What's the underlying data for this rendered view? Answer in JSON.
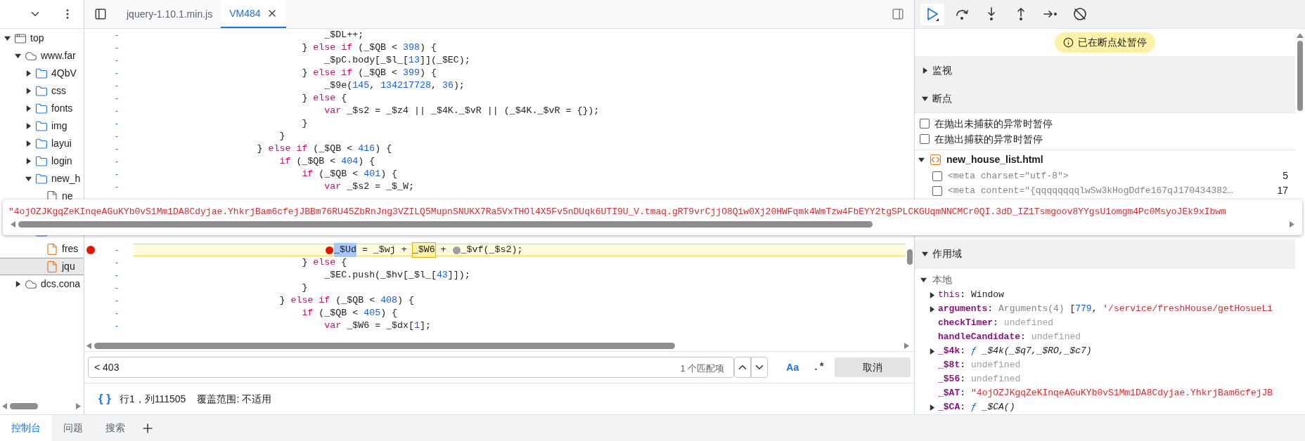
{
  "navigator": {
    "tree": [
      {
        "label": "top",
        "kind": "frame",
        "expanded": true,
        "selected": false,
        "children": [
          {
            "label": "www.far",
            "kind": "domain",
            "expanded": true,
            "selected": false,
            "children": [
              {
                "label": "4QbV",
                "kind": "folder",
                "expanded": false,
                "selected": false
              },
              {
                "label": "css",
                "kind": "folder",
                "expanded": false,
                "selected": false
              },
              {
                "label": "fonts",
                "kind": "folder",
                "expanded": false,
                "selected": false
              },
              {
                "label": "img",
                "kind": "folder",
                "expanded": false,
                "selected": false
              },
              {
                "label": "layui",
                "kind": "folder",
                "expanded": false,
                "selected": false
              },
              {
                "label": "login",
                "kind": "folder",
                "expanded": false,
                "selected": false
              },
              {
                "label": "new_h",
                "kind": "folder",
                "expanded": true,
                "selected": false,
                "children": [
                  {
                    "label": "ne",
                    "kind": "document",
                    "selected": false
                  }
                ]
              },
              {
                "kind": "folder",
                "selected": false,
                "children": [
                  {
                    "label": "fres",
                    "kind": "script",
                    "selected": false
                  },
                  {
                    "label": "jqu",
                    "kind": "script",
                    "selected": true
                  }
                ]
              }
            ]
          },
          {
            "label": "dcs.cona",
            "kind": "domain",
            "expanded": false,
            "selected": false
          }
        ]
      }
    ]
  },
  "editor": {
    "tabs": [
      {
        "label": "jquery-1.10.1.min.js",
        "selected": false,
        "closable": false
      },
      {
        "label": "VM484",
        "selected": true,
        "closable": true
      }
    ],
    "gutter_mark": "-",
    "lines": [
      {
        "kind": "code",
        "text": "                                  _$DL++;"
      },
      {
        "kind": "code",
        "text": "                              } else if (_$QB < 398) {"
      },
      {
        "kind": "code",
        "text": "                                  _$pC.body[_$l_[13]](_$EC);"
      },
      {
        "kind": "code",
        "text": "                              } else if (_$QB < 399) {"
      },
      {
        "kind": "code",
        "text": "                                  _$9e(145, 134217728, 36);"
      },
      {
        "kind": "code",
        "text": "                              } else {"
      },
      {
        "kind": "code",
        "text": "                                  var _$s2 = _$z4 || _$4K._$vR || (_$4K._$vR = {});"
      },
      {
        "kind": "code",
        "text": "                              }"
      },
      {
        "kind": "code",
        "text": "                          }"
      },
      {
        "kind": "code",
        "text": "                      } else if (_$QB < 416) {"
      },
      {
        "kind": "code",
        "text": "                          if (_$QB < 404) {"
      },
      {
        "kind": "code",
        "text": "                              if (_$QB < 401) {"
      },
      {
        "kind": "code",
        "text": "                                  var _$s2 = _$_W;"
      },
      {
        "kind": "covered"
      },
      {
        "kind": "covered"
      },
      {
        "kind": "covered"
      },
      {
        "kind": "covered"
      },
      {
        "kind": "paused",
        "breakpoint": true,
        "parts": [
          {
            "text": "_$Ud",
            "selected": true,
            "hovered": false,
            "inline_breakpoint": true,
            "breakpoint_enabled": true
          },
          {
            "text": " = _$wj + ",
            "selected": false,
            "hovered": false,
            "inline_breakpoint": false
          },
          {
            "text": "_$W6",
            "selected": false,
            "hovered": true,
            "inline_breakpoint": false
          },
          {
            "text": " + ",
            "selected": false,
            "hovered": false,
            "inline_breakpoint": false
          },
          {
            "text": "_$vf(_$s2);",
            "selected": false,
            "hovered": false,
            "inline_breakpoint": true,
            "breakpoint_enabled": false
          }
        ]
      },
      {
        "kind": "code",
        "text": "                              } else {"
      },
      {
        "kind": "code",
        "text": "                                  _$EC.push(_$hv[_$l_[43]]);"
      },
      {
        "kind": "code",
        "text": "                              }"
      },
      {
        "kind": "code",
        "text": "                          } else if (_$QB < 408) {"
      },
      {
        "kind": "code",
        "text": "                              if (_$QB < 405) {"
      },
      {
        "kind": "code",
        "text": "                                  var _$W6 = _$dx[1];"
      }
    ],
    "search": {
      "value": "< 403",
      "matches": "1 个匹配项",
      "match_case": "Aa",
      "regex": ".*",
      "cancel": "取消"
    },
    "status": {
      "pretty_print": "{ }",
      "position": "行1，列111505",
      "coverage": "覆盖范围: 不适用"
    }
  },
  "tooltip": {
    "value": "\"4ojOZJKgqZeKInqeAGuKYb0vS1Mm1DA8Cdyjae.YhkrjBam6cfejJBBm76RU45ZbRnJng3VZILQ5MupnSNUKX7Ra5VxTHOl4X5Fv5nDUqk6UTI9U_V.tmaq.gRT9vrCjjO8Qiw0Xj20HWFqmk4WmTzw4FbEYY2tgSPLCKGUqmNNCMCr0QI.3dD_IZ1Tsmgoov8YYgsU1omgm4Pc0MsyoJEk9xIbwm"
  },
  "debugger": {
    "toolbar": [
      {
        "kind": "resume",
        "active": true
      },
      {
        "kind": "step_over",
        "active": false
      },
      {
        "kind": "step_into",
        "active": false
      },
      {
        "kind": "step_out",
        "active": false
      },
      {
        "kind": "step",
        "active": false
      },
      {
        "kind": "deactivate",
        "active": false
      }
    ],
    "paused_banner": "已在断点处暂停",
    "watch": {
      "title": "监视",
      "expanded": false
    },
    "breakpoints": {
      "title": "断点",
      "expanded": true,
      "options": [
        {
          "label": "在抛出未捕获的异常时暂停",
          "checked": false
        },
        {
          "label": "在抛出捕获的异常时暂停",
          "checked": false
        }
      ],
      "file": "new_house_list.html",
      "file_expanded": true,
      "items": [
        {
          "code": "<meta charset=\"utf-8\">",
          "line": "5",
          "checked": false
        },
        {
          "code": "<meta content=\"{qqqqqqqqlwSw3kHogDdfe167qJ170434382…",
          "line": "17",
          "checked": false
        }
      ]
    },
    "scope": {
      "title": "作用域",
      "expanded": true,
      "local": {
        "title": "本地",
        "expanded": true,
        "vars": [
          {
            "name": "this",
            "sep": ":",
            "own": false,
            "expandable": true,
            "parts": [
              {
                "text": "Window",
                "kind": "object"
              }
            ]
          },
          {
            "name": "arguments",
            "sep": ":",
            "own": true,
            "expandable": true,
            "parts": [
              {
                "text": "Arguments(4) ",
                "kind": "type"
              },
              {
                "text": "[",
                "kind": "object"
              },
              {
                "text": "779",
                "kind": "number"
              },
              {
                "text": ", ",
                "kind": "object"
              },
              {
                "text": "'/service/freshHouse/getHosueLi",
                "kind": "string"
              }
            ]
          },
          {
            "name": "checkTimer",
            "sep": ":",
            "own": true,
            "expandable": false,
            "parts": [
              {
                "text": "undefined",
                "kind": "undefined"
              }
            ]
          },
          {
            "name": "handleCandidate",
            "sep": ":",
            "own": true,
            "expandable": false,
            "parts": [
              {
                "text": "undefined",
                "kind": "undefined"
              }
            ]
          },
          {
            "name": "_$4k",
            "sep": ":",
            "own": true,
            "expandable": true,
            "parts": [
              {
                "text": "ƒ",
                "kind": "keyword"
              },
              {
                "text": " _$4k(_$q7,_$RO,_$c7)",
                "kind": "function"
              }
            ]
          },
          {
            "name": "_$8t",
            "sep": ":",
            "own": true,
            "expandable": false,
            "parts": [
              {
                "text": "undefined",
                "kind": "undefined"
              }
            ]
          },
          {
            "name": "_$56",
            "sep": ":",
            "own": true,
            "expandable": false,
            "parts": [
              {
                "text": "undefined",
                "kind": "undefined"
              }
            ]
          },
          {
            "name": "_$AT",
            "sep": ":",
            "own": true,
            "expandable": false,
            "parts": [
              {
                "text": "\"4ojOZJKgqZeKInqeAGuKYb0vS1Mm1DA8Cdyjae.YhkrjBam6cfejJB",
                "kind": "string"
              }
            ]
          },
          {
            "name": "_$CA",
            "sep": ":",
            "own": true,
            "expandable": true,
            "parts": [
              {
                "text": "ƒ",
                "kind": "keyword"
              },
              {
                "text": " _$CA()",
                "kind": "function"
              }
            ]
          }
        ]
      }
    }
  },
  "drawer": {
    "tabs": [
      {
        "label": "控制台",
        "selected": true
      },
      {
        "label": "问题",
        "selected": false
      },
      {
        "label": "搜索",
        "selected": false
      }
    ]
  }
}
